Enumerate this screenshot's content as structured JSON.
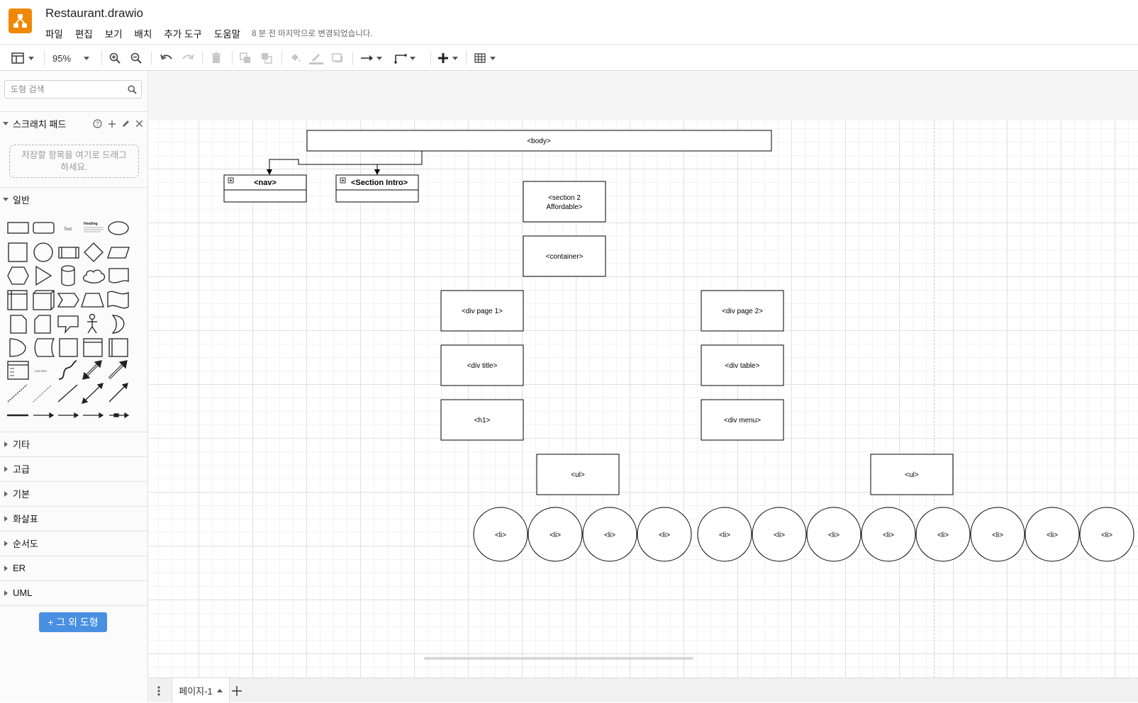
{
  "header": {
    "file_title": "Restaurant.drawio",
    "menus": [
      "파일",
      "편집",
      "보기",
      "배치",
      "추가 도구",
      "도움말"
    ],
    "last_modified": "8 분 전 마지막으로 변경되었습니다."
  },
  "toolbar": {
    "zoom": "95%",
    "icons": [
      "format-panel-icon",
      "zoom-in-icon",
      "zoom-out-icon",
      "undo-icon",
      "redo-icon",
      "delete-icon",
      "to-front-icon",
      "to-back-icon",
      "fill-color-icon",
      "line-color-icon",
      "shadow-icon",
      "connection-icon",
      "waypoints-icon",
      "insert-icon",
      "table-icon"
    ]
  },
  "sidebar": {
    "search_placeholder": "도형 검색",
    "scratchpad": {
      "title": "스크래치 패드",
      "drop_hint_line1": "저장할 항목을 여기로 드래그",
      "drop_hint_line2": "하세요."
    },
    "general": {
      "title": "일반",
      "text_shape": "Text",
      "heading_shape": "Heading",
      "list_item_shape": "List Item"
    },
    "categories": [
      "기타",
      "고급",
      "기본",
      "화살표",
      "순서도",
      "ER",
      "UML"
    ],
    "more_shapes": "+ 그 외 도형"
  },
  "diagram": {
    "body": "<body>",
    "nav": "<nav>",
    "section_intro": "<Section Intro>",
    "section2_line1": "<section 2",
    "section2_line2": "Affordable>",
    "container": "<container>",
    "div_page1": "<div page 1>",
    "div_page2": "<div page 2>",
    "div_title": "<div title>",
    "div_table": "<div table>",
    "h1": "<h1>",
    "div_menu": "<div menu>",
    "ul_left": "<ul>",
    "ul_right": "<ul>",
    "li_items": [
      "<li>",
      "<li>",
      "<li>",
      "<li>",
      "<li>",
      "<li>",
      "<li>",
      "<li>",
      "<li>",
      "<li>",
      "<li>",
      "<li>"
    ]
  },
  "footer": {
    "page_tab": "페이지-1"
  }
}
